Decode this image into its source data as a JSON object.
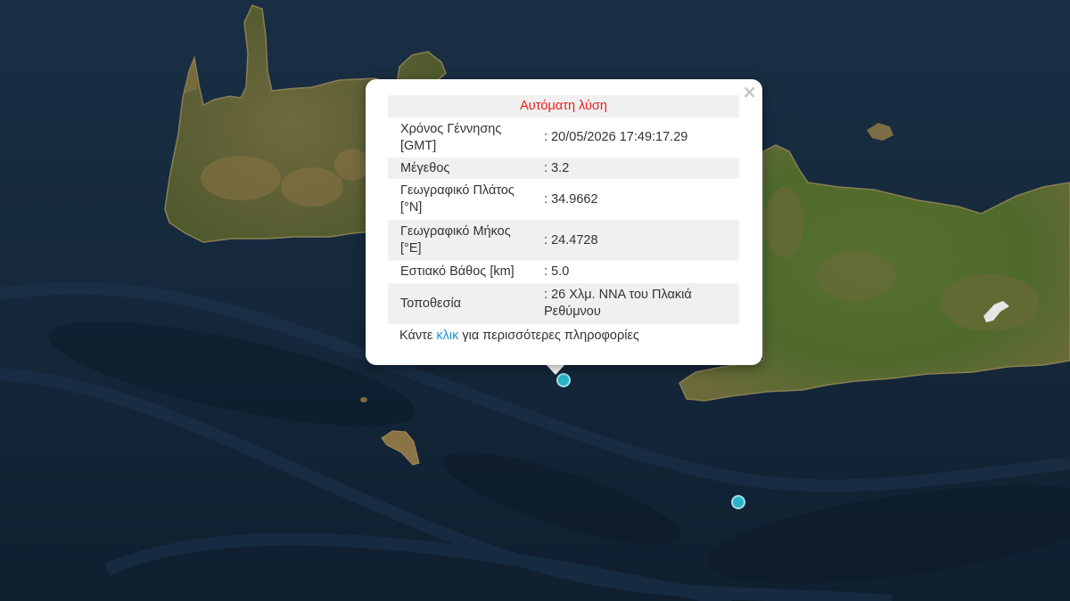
{
  "popup": {
    "title": "Αυτόματη λύση",
    "close_label": "×",
    "rows": [
      {
        "label": "Χρόνος Γέννησης [GMT]",
        "value": ": 20/05/2026 17:49:17.29"
      },
      {
        "label": "Μέγεθος",
        "value": ": 3.2"
      },
      {
        "label": "Γεωγραφικό Πλάτος [°N]",
        "value": ": 34.9662"
      },
      {
        "label": "Γεωγραφικό Μήκος [°E]",
        "value": ": 24.4728"
      },
      {
        "label": "Εστιακό Βάθος [km]",
        "value": ": 5.0"
      },
      {
        "label": "Τοποθεσία",
        "value": ": 26 Χλμ. ΝΝΑ του Πλακιά Ρεθύμνου"
      }
    ],
    "more_prefix": "Κάντε",
    "more_link": "κλικ",
    "more_suffix": "για περισσότερες πληροφορίες"
  },
  "colors": {
    "sea": "#14273a",
    "land": "#5b6a33",
    "marker": "#2ab3c6",
    "title_red": "#e8201d",
    "link_blue": "#1795d4"
  }
}
